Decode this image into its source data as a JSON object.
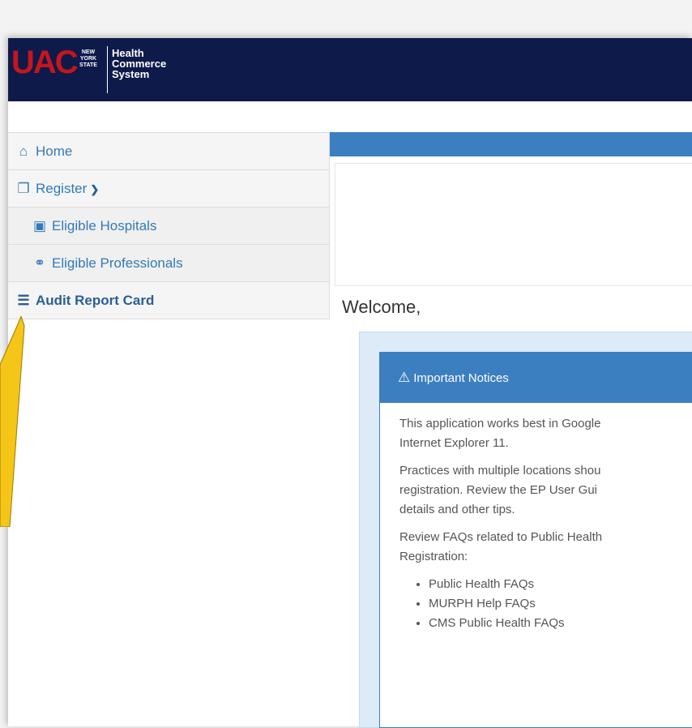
{
  "header": {
    "logo_text": "UAC",
    "state_line1": "NEW",
    "state_line2": "YORK",
    "state_line3": "STATE",
    "hcs_line1": "Health",
    "hcs_line2": "Commerce",
    "hcs_line3": "System",
    "background_color": "#0e1a4a"
  },
  "sidebar": {
    "items": [
      {
        "label": "Home",
        "icon": "home-icon"
      },
      {
        "label": "Register",
        "icon": "register-icon",
        "expanded": true
      },
      {
        "label": "Eligible Hospitals",
        "icon": "hospital-icon"
      },
      {
        "label": "Eligible Professionals",
        "icon": "stethoscope-icon"
      },
      {
        "label": "Audit Report Card",
        "icon": "list-icon"
      }
    ]
  },
  "main": {
    "welcome": "Welcome,",
    "notices": {
      "title": "Important Notices",
      "para1_line1": "This application works best in Google",
      "para1_line2": "Internet Explorer 11.",
      "para2_line1": "Practices with multiple locations shou",
      "para2_line2": "registration. Review the EP User Gui",
      "para2_line3": "details and other tips.",
      "para3_line1": "Review FAQs related to Public Health",
      "para3_line2": "Registration:",
      "links": [
        "Public Health FAQs",
        "MURPH Help FAQs",
        "CMS Public Health FAQs"
      ]
    }
  },
  "colors": {
    "accent": "#3c7fc1",
    "link": "#337ab7",
    "arrow": "#f5c518"
  }
}
